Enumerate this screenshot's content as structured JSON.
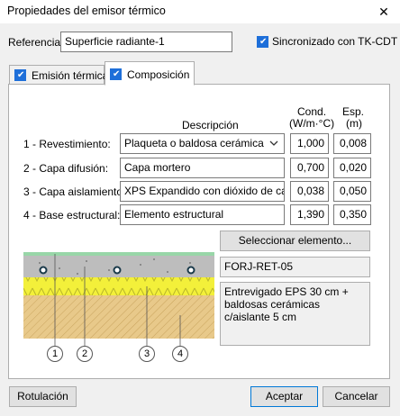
{
  "window": {
    "title": "Propiedades del emisor térmico",
    "close_glyph": "✕"
  },
  "referencia": {
    "label": "Referencia:",
    "value": "Superficie radiante-1"
  },
  "sincronizado": {
    "label": "Sincronizado con TK-CDT",
    "checked": true
  },
  "tabs": [
    {
      "label": "Emisión térmica",
      "checked": true,
      "active": false
    },
    {
      "label": "Composición",
      "checked": true,
      "active": true
    }
  ],
  "columns": {
    "descripcion": "Descripción",
    "cond": "Cond.",
    "cond_unit": "(W/m·°C)",
    "esp": "Esp.",
    "esp_unit": "(m)"
  },
  "layers": [
    {
      "label": "1 - Revestimiento:",
      "description": "Plaqueta o baldosa cerámica",
      "cond": "1,000",
      "esp": "0,008",
      "dropdown": true
    },
    {
      "label": "2 - Capa difusión:",
      "description": "Capa mortero",
      "cond": "0,700",
      "esp": "0,020",
      "dropdown": false
    },
    {
      "label": "3 - Capa aislamiento:",
      "description": "XPS Expandido con dióxido de carbor",
      "cond": "0,038",
      "esp": "0,050",
      "dropdown": false
    },
    {
      "label": "4 - Base estructural:",
      "description": "Elemento estructural",
      "cond": "1,390",
      "esp": "0,350",
      "dropdown": false
    }
  ],
  "select_button": "Seleccionar elemento...",
  "element_code": "FORJ-RET-05",
  "element_description": "Entrevigado EPS 30 cm + baldosas cerámicas c/aislante 5 cm",
  "markers": [
    "1",
    "2",
    "3",
    "4"
  ],
  "buttons": {
    "rotulacion": "Rotulación",
    "aceptar": "Aceptar",
    "cancelar": "Cancelar"
  },
  "colors": {
    "accent": "#0078d7",
    "check": "#1e6fd9",
    "insulation": "#f3f03a",
    "base": "#e8c98a",
    "mortar": "#bdbdbd",
    "tile": "#98d6a8"
  }
}
